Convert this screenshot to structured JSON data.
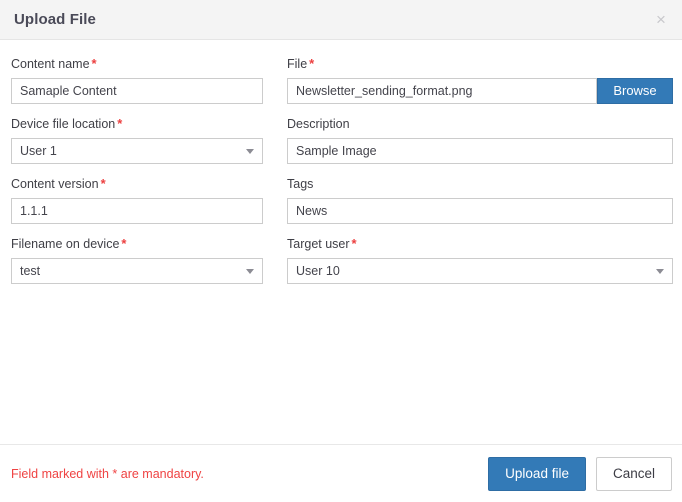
{
  "dialog": {
    "title": "Upload File",
    "close_icon": "close-icon",
    "close_label": "×"
  },
  "form": {
    "fields": [
      {
        "id": "content-name",
        "label": "Content name",
        "required": true,
        "type": "text",
        "value": "Samaple Content",
        "placeholder": ""
      },
      {
        "id": "file",
        "label": "File",
        "required": true,
        "type": "file",
        "value": "Newsletter_sending_format.png",
        "placeholder": "",
        "browse_label": "Browse"
      },
      {
        "id": "device-file-location",
        "label": "Device file location",
        "required": true,
        "type": "select",
        "value": "User 1",
        "caret_icon": "chevron-down-icon"
      },
      {
        "id": "description",
        "label": "Description",
        "required": false,
        "type": "text",
        "value": "Sample Image",
        "placeholder": ""
      },
      {
        "id": "content-version",
        "label": "Content version",
        "required": true,
        "type": "text",
        "value": "1.1.1",
        "placeholder": ""
      },
      {
        "id": "tags",
        "label": "Tags",
        "required": false,
        "type": "text",
        "value": "News",
        "placeholder": ""
      },
      {
        "id": "filename-on-device",
        "label": "Filename on device",
        "required": true,
        "type": "select",
        "value": "test",
        "caret_icon": "chevron-down-icon"
      },
      {
        "id": "target-user",
        "label": "Target user",
        "required": true,
        "type": "select",
        "value": "User 10",
        "caret_icon": "chevron-down-icon"
      }
    ],
    "required_marker": "*"
  },
  "footer": {
    "mandatory_note": "Field marked with * are mandatory.",
    "submit_label": "Upload file",
    "cancel_label": "Cancel"
  },
  "colors": {
    "accent": "#337ab7",
    "required": "#ec3f3f",
    "note": "#ef4343",
    "header_bg": "#f4f4f4",
    "border": "#cccccc"
  }
}
